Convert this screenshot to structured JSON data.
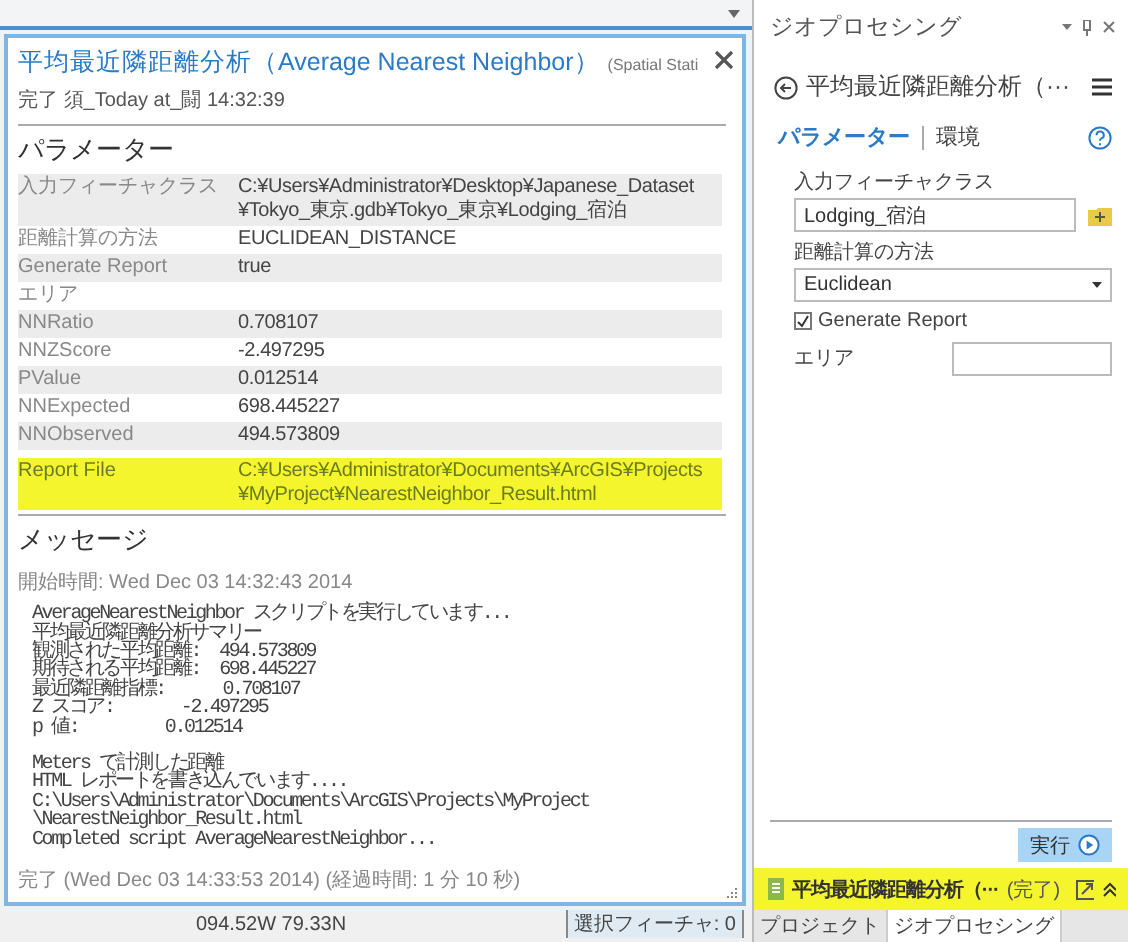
{
  "result_panel": {
    "title": "平均最近隣距離分析（Average Nearest Neighbor）",
    "subtitle_tail": "(Spatial Stati",
    "status": "完了 須_Today at_闘 14:32:39",
    "parameters_heading": "パラメーター",
    "parameters": [
      {
        "name": "入力フィーチャクラス",
        "value_lines": [
          "C:¥Users¥Administrator¥Desktop¥Japanese_Dataset",
          "¥Tokyo_東京.gdb¥Tokyo_東京¥Lodging_宿泊"
        ],
        "highlighted": false
      },
      {
        "name": "距離計算の方法",
        "value_lines": [
          "EUCLIDEAN_DISTANCE"
        ],
        "highlighted": false
      },
      {
        "name": "Generate Report",
        "value_lines": [
          "true"
        ],
        "highlighted": false
      },
      {
        "name": "エリア",
        "highlighted": false
      },
      {
        "name": "NNRatio",
        "value_lines": [
          "0.708107"
        ],
        "highlighted": false
      },
      {
        "name": "NNZScore",
        "value_lines": [
          "-2.497295"
        ],
        "highlighted": false
      },
      {
        "name": "PValue",
        "value_lines": [
          "0.012514"
        ],
        "highlighted": false
      },
      {
        "name": "NNExpected",
        "value_lines": [
          "698.445227"
        ],
        "highlighted": false
      },
      {
        "name": "NNObserved",
        "value_lines": [
          "494.573809"
        ],
        "highlighted": false
      },
      {
        "name": "Report File",
        "value_lines": [
          "C:¥Users¥Administrator¥Documents¥ArcGIS¥Projects",
          "¥MyProject¥NearestNeighbor_Result.html"
        ],
        "highlighted": true
      }
    ],
    "messages_heading": "メッセージ",
    "start_time": "開始時間: Wed Dec 03 14:32:43 2014",
    "message_blocks": [
      [
        "AverageNearestNeighbor スクリプトを実行しています...",
        "平均最近隣距離分析サマリー",
        "観測された平均距離:  494.573809",
        "期待される平均距離:  698.445227",
        "最近隣距離指標:      0.708107",
        "Z スコア:       -2.497295",
        "p 値:         0.012514"
      ],
      [
        "Meters で計測した距離",
        "HTML レポートを書き込んでいます....",
        "C:\\Users\\Administrator\\Documents\\ArcGIS\\Projects\\MyProject",
        "\\NearestNeighbor_Result.html",
        "Completed script AverageNearestNeighbor..."
      ]
    ],
    "end_time": "完了 (Wed Dec 03 14:33:53 2014) (経過時間: 1 分 10 秒)"
  },
  "status_bar": {
    "coordinates": "094.52W 79.33N",
    "selected_features": "選択フィーチャ: 0"
  },
  "geoprocessing": {
    "pane_title": "ジオプロセシング",
    "tool_title": "平均最近隣距離分析（···",
    "tabs": [
      {
        "label": "パラメーター",
        "selected": true
      },
      {
        "label": "環境",
        "selected": false
      }
    ],
    "input_label": "入力フィーチャクラス",
    "input_value": "Lodging_宿泊",
    "method_label": "距離計算の方法",
    "method_value": "Euclidean",
    "generate_report": {
      "label": "Generate Report",
      "checked": true
    },
    "area_label": "エリア",
    "run_button": "実行",
    "result_bar": {
      "title": "平均最近隣距離分析（···",
      "status": "(完了)"
    },
    "bottom_tabs": [
      {
        "label": "プロジェクト",
        "selected": false
      },
      {
        "label": "ジオプロセシング",
        "selected": true
      }
    ]
  }
}
